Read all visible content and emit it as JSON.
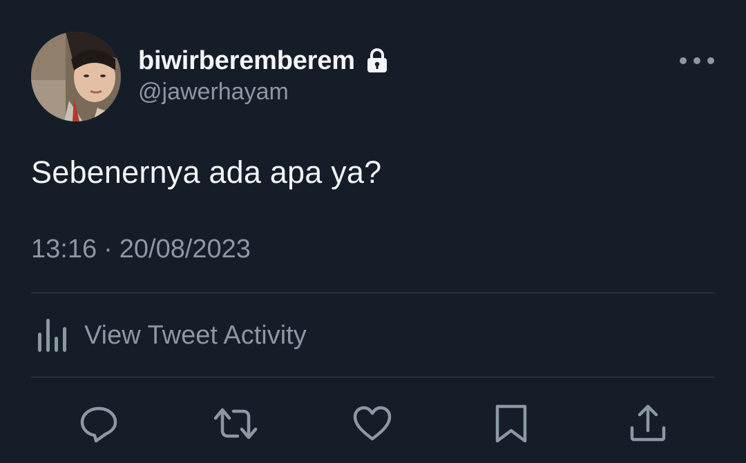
{
  "tweet": {
    "display_name": "biwirberemberem",
    "handle": "@jawerhayam",
    "text": "Sebenernya ada apa ya?",
    "time": "13:16",
    "separator": "·",
    "date": "20/08/2023",
    "activity_label": "View Tweet Activity"
  },
  "icons": {
    "lock": "lock-icon",
    "more": "more-horizontal-icon",
    "activity": "bar-chart-icon",
    "reply": "reply-icon",
    "retweet": "retweet-icon",
    "like": "heart-icon",
    "bookmark": "bookmark-icon",
    "share": "share-icon"
  },
  "colors": {
    "background": "#151d28",
    "primary_text": "#f3f4f5",
    "secondary_text": "#8b98a5",
    "divider": "#38444d"
  }
}
